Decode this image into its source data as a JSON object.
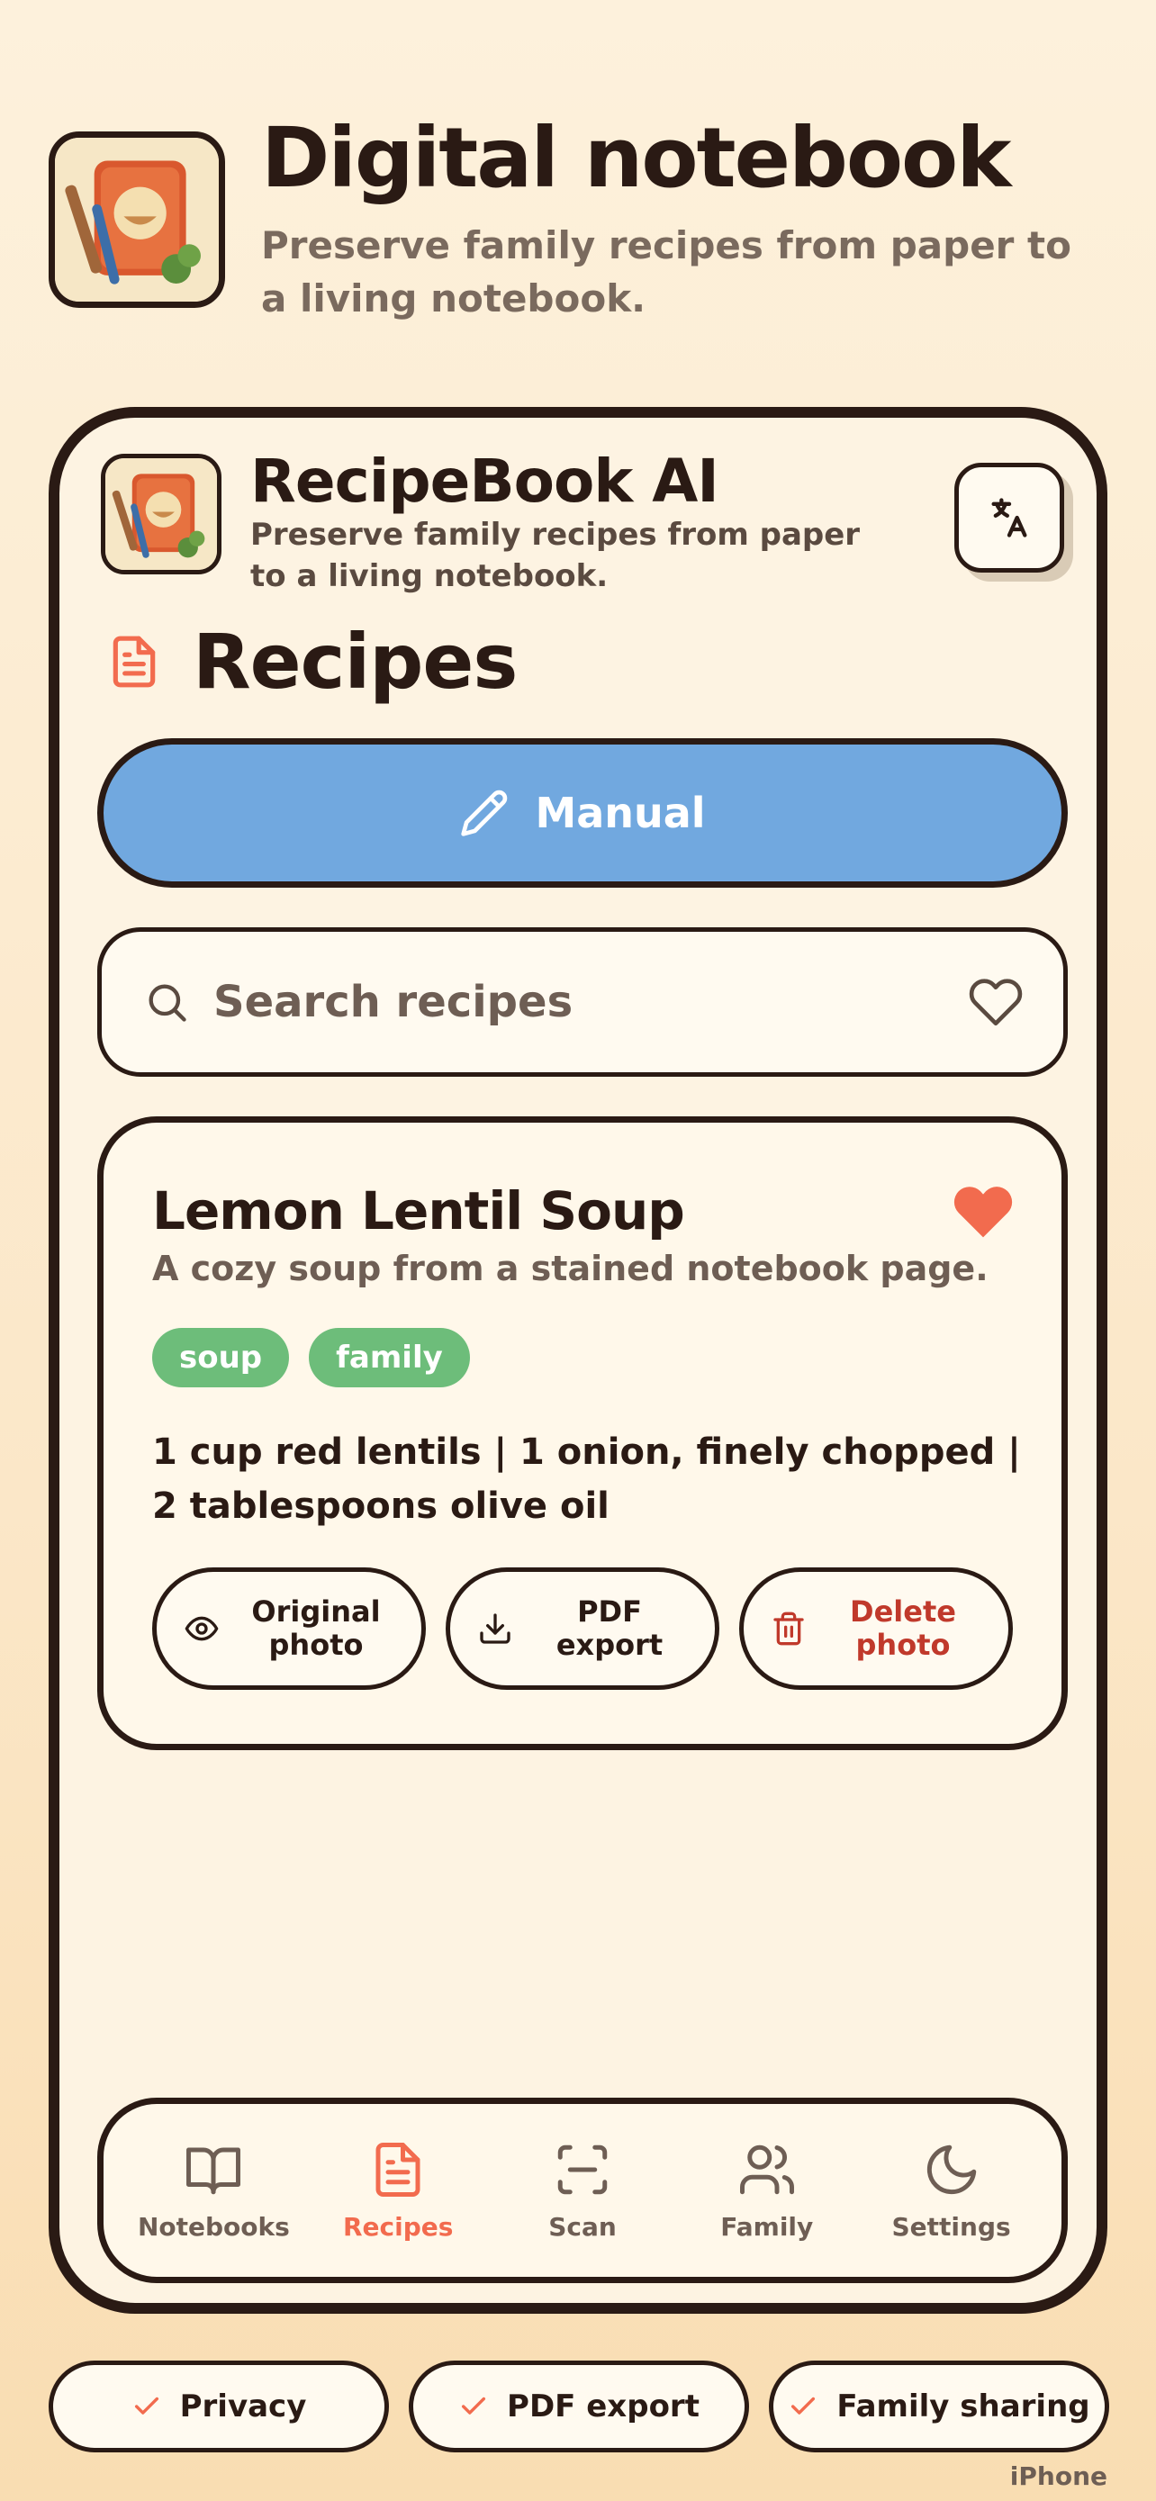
{
  "hero": {
    "title": "Digital notebook",
    "subtitle": "Preserve family recipes from paper to a living notebook."
  },
  "app": {
    "name": "RecipeBook AI",
    "tagline": "Preserve family recipes from paper to a living notebook."
  },
  "icons": {
    "translate": "translate-icon",
    "section": "document-icon",
    "manual": "pencil-icon",
    "search": "search-icon",
    "favorite_filter": "heart-outline-icon",
    "favorite": "heart-filled-icon"
  },
  "section": {
    "title": "Recipes"
  },
  "manual_button": {
    "label": "Manual"
  },
  "search": {
    "placeholder": "Search recipes"
  },
  "recipe": {
    "title": "Lemon Lentil Soup",
    "description": "A cozy soup from a stained notebook page.",
    "tags": [
      "soup",
      "family"
    ],
    "ingredients": "1 cup red lentils  |  1 onion, finely chopped  |  2 tablespoons olive oil",
    "favorite": true,
    "actions": [
      {
        "label": "Original\nphoto",
        "icon": "eye-icon"
      },
      {
        "label": "PDF\nexport",
        "icon": "download-icon"
      },
      {
        "label": "Delete\nphoto",
        "icon": "trash-icon"
      }
    ]
  },
  "nav": {
    "items": [
      {
        "label": "Notebooks",
        "icon": "book-icon",
        "active": false
      },
      {
        "label": "Recipes",
        "icon": "document-icon",
        "active": true
      },
      {
        "label": "Scan",
        "icon": "scan-icon",
        "active": false
      },
      {
        "label": "Family",
        "icon": "users-icon",
        "active": false
      },
      {
        "label": "Settings",
        "icon": "moon-icon",
        "active": false
      }
    ]
  },
  "features": [
    {
      "label": "Privacy"
    },
    {
      "label": "PDF export"
    },
    {
      "label": "Family sharing"
    }
  ],
  "device": "iPhone",
  "colors": {
    "accent_blue": "#71a8df",
    "accent_coral": "#f26b4e",
    "tag_green": "#6dbd7a",
    "danger": "#c0392b",
    "ink": "#2a1a14"
  }
}
